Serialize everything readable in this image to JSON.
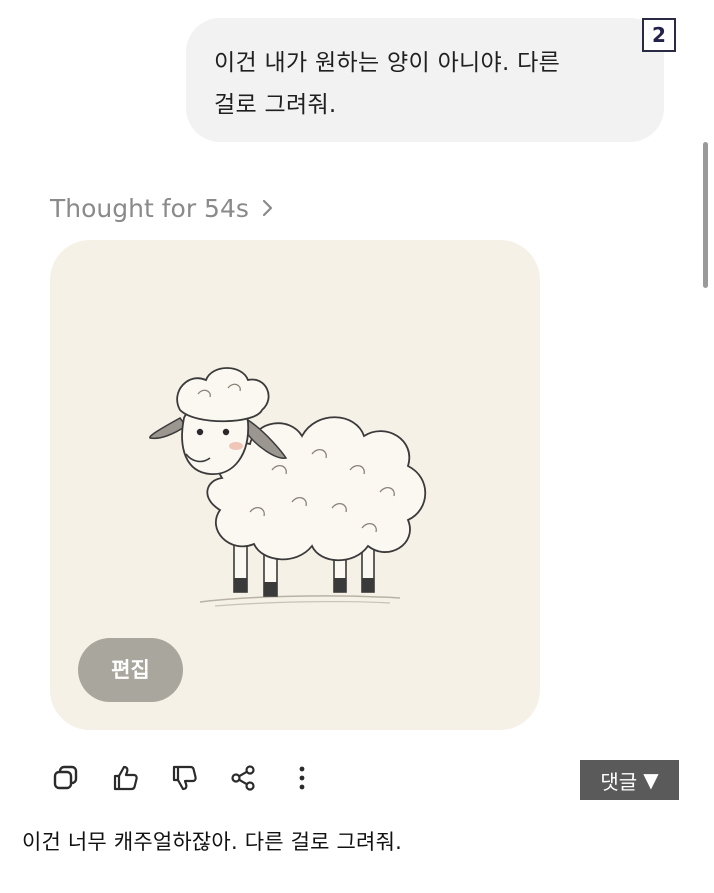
{
  "user_message": {
    "line1": "이건 내가 원하는 양이 아니야. 다른",
    "line2": "걸로 그려줘."
  },
  "page_badge": "2",
  "thought": {
    "label": "Thought for 54s",
    "chevron_icon": "chevron-right-icon"
  },
  "image": {
    "subject_icon": "sheep-drawing",
    "edit_label": "편집"
  },
  "actions": {
    "icons": [
      "copy-icon",
      "thumbs-up-icon",
      "thumbs-down-icon",
      "share-icon",
      "more-vertical-icon"
    ]
  },
  "comment_button": {
    "label": "댓글",
    "arrow": "▼"
  },
  "caption": "이건 너무 캐주얼하잖아. 다른 걸로 그려줘.",
  "colors": {
    "bubble_bg": "#f2f2f2",
    "card_bg": "#f6f1e6",
    "edit_bg": "#a9a69d",
    "comment_bg": "#5a5a5a"
  }
}
